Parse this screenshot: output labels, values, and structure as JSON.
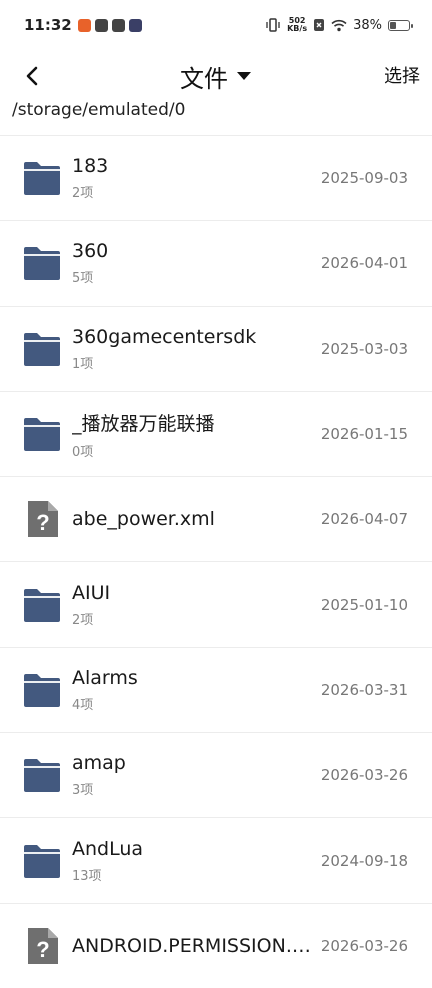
{
  "status_bar": {
    "time": "11:32",
    "net_speed_value": "502",
    "net_speed_unit": "KB/s",
    "battery_percent": "38%",
    "battery_level": 0.38
  },
  "header": {
    "title": "文件",
    "select_label": "选择"
  },
  "path": "/storage/emulated/0",
  "items": [
    {
      "type": "folder",
      "name": "183",
      "count": "2项",
      "date": "2025-09-03"
    },
    {
      "type": "folder",
      "name": "360",
      "count": "5项",
      "date": "2026-04-01"
    },
    {
      "type": "folder",
      "name": "360gamecentersdk",
      "count": "1项",
      "date": "2025-03-03"
    },
    {
      "type": "folder",
      "name": "_播放器万能联播",
      "count": "0项",
      "date": "2026-01-15"
    },
    {
      "type": "file",
      "name": "abe_power.xml",
      "count": "",
      "date": "2026-04-07"
    },
    {
      "type": "folder",
      "name": "AIUI",
      "count": "2项",
      "date": "2025-01-10"
    },
    {
      "type": "folder",
      "name": "Alarms",
      "count": "4项",
      "date": "2026-03-31"
    },
    {
      "type": "folder",
      "name": "amap",
      "count": "3项",
      "date": "2026-03-26"
    },
    {
      "type": "folder",
      "name": "AndLua",
      "count": "13项",
      "date": "2024-09-18"
    },
    {
      "type": "file",
      "name": "ANDROID.PERMISSION.TEST",
      "count": "",
      "date": "2026-03-26"
    }
  ],
  "colors": {
    "folder": "#43597f",
    "file": "#6f6f6f"
  }
}
